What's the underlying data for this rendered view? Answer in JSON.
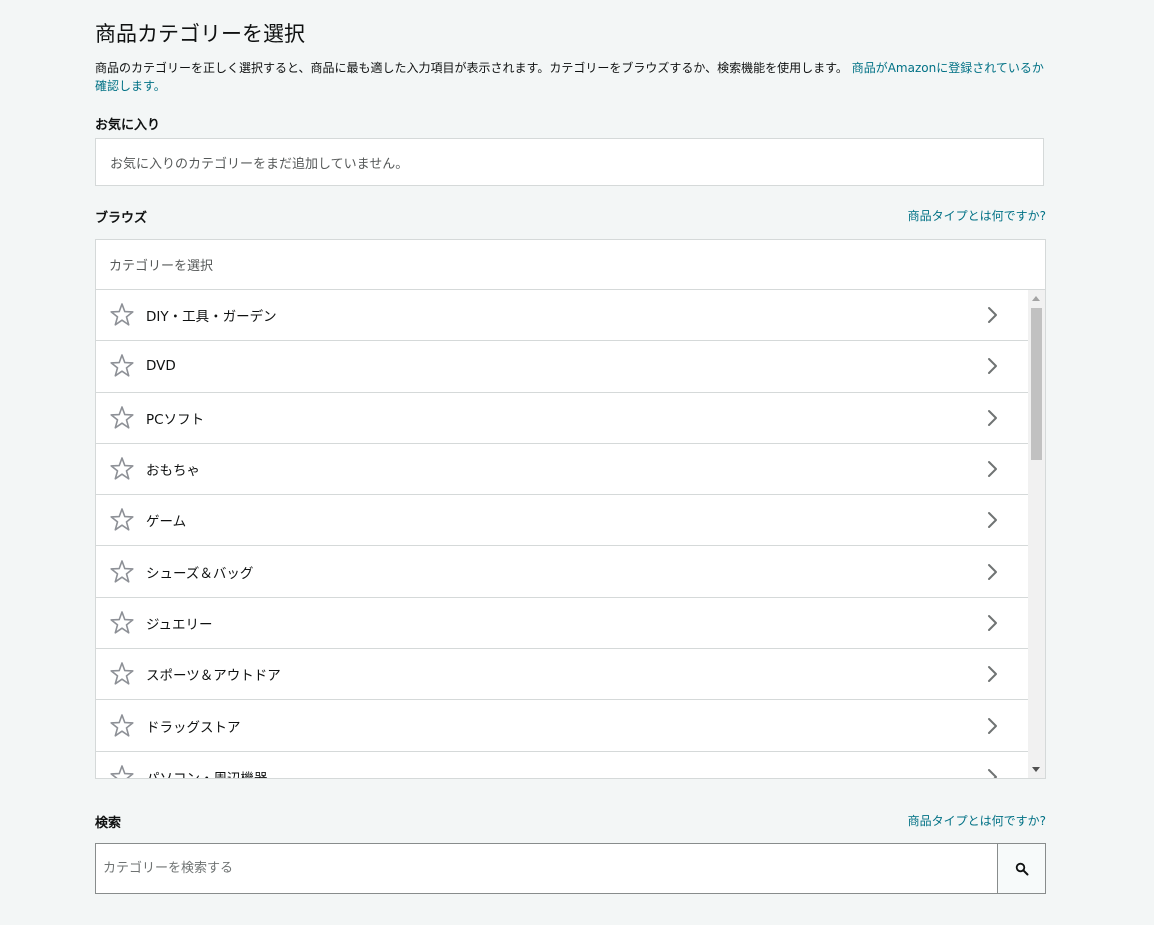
{
  "page": {
    "title": "商品カテゴリーを選択",
    "intro_text": "商品のカテゴリーを正しく選択すると、商品に最も適した入力項目が表示されます。カテゴリーをブラウズするか、検索機能を使用します。",
    "intro_link": "商品がAmazonに登録されているか確認します。"
  },
  "favorites": {
    "label": "お気に入り",
    "empty_text": "お気に入りのカテゴリーをまだ追加していません。"
  },
  "browse": {
    "label": "ブラウズ",
    "help_link": "商品タイプとは何ですか?",
    "header": "カテゴリーを選択",
    "categories": [
      "DIY・工具・ガーデン",
      "DVD",
      "PCソフト",
      "おもちゃ",
      "ゲーム",
      "シューズ＆バッグ",
      "ジュエリー",
      "スポーツ＆アウトドア",
      "ドラッグストア",
      "パソコン・周辺機器"
    ]
  },
  "search": {
    "label": "検索",
    "help_link": "商品タイプとは何ですか?",
    "placeholder": "カテゴリーを検索する",
    "value": ""
  },
  "colors": {
    "link": "#007185",
    "background": "#f3f6f6",
    "border": "#d5d9d9",
    "icon": "#8d9096"
  }
}
